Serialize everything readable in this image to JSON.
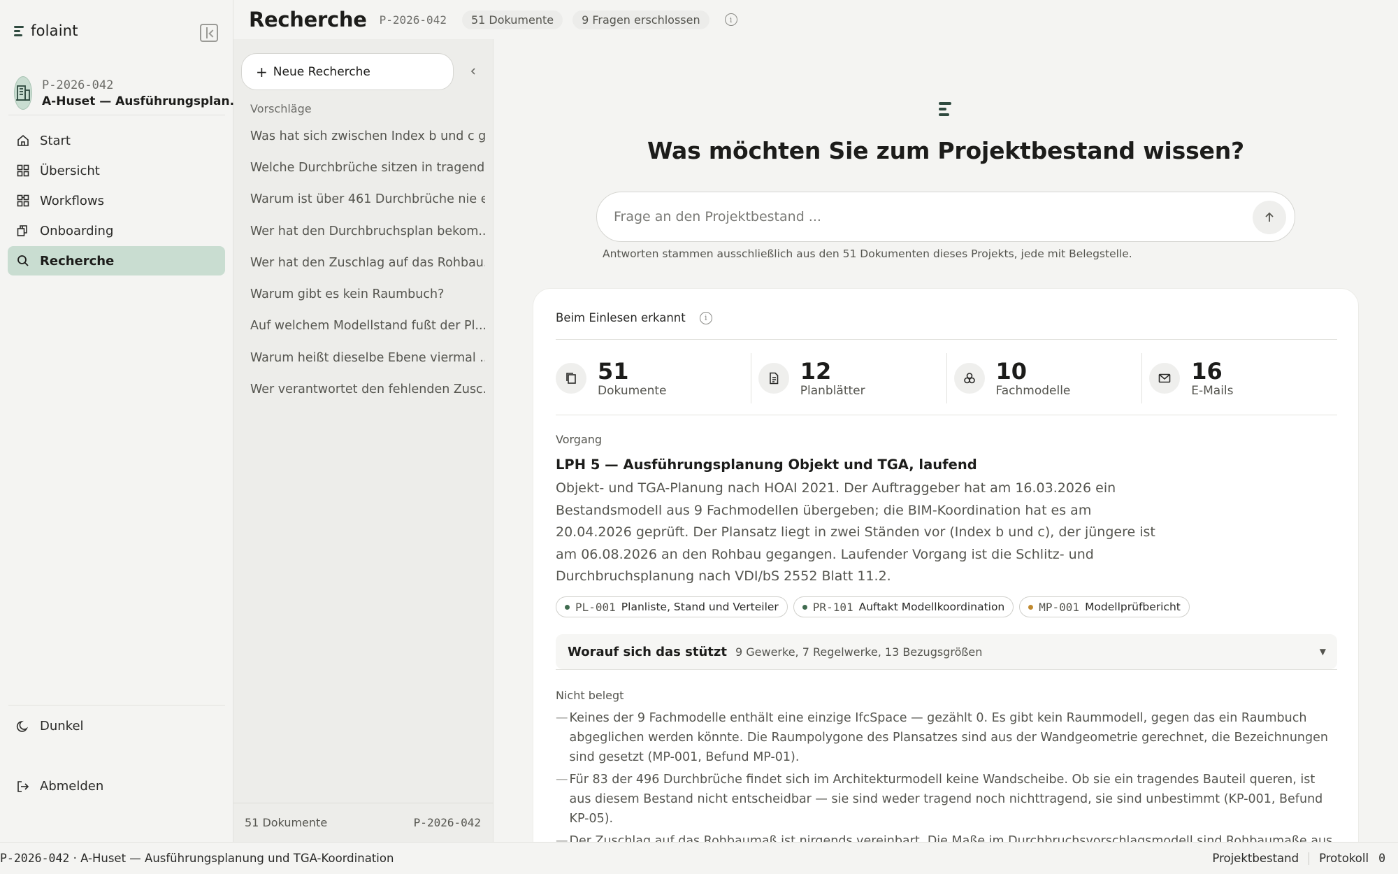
{
  "brand": {
    "name": "folaint"
  },
  "project": {
    "id": "P-2026-042",
    "name": "A-Huset — Ausführungsplan..."
  },
  "nav": [
    {
      "label": "Start",
      "icon": "home-icon"
    },
    {
      "label": "Übersicht",
      "icon": "grid-icon"
    },
    {
      "label": "Workflows",
      "icon": "workflows-icon"
    },
    {
      "label": "Onboarding",
      "icon": "onboarding-icon"
    },
    {
      "label": "Recherche",
      "icon": "search-icon",
      "active": true
    }
  ],
  "bottom": {
    "theme_label": "Dunkel",
    "logout_label": "Abmelden"
  },
  "header": {
    "title": "Recherche",
    "id": "P-2026-042",
    "documents_pill": "51 Dokumente",
    "questions_pill": "9 Fragen erschlossen"
  },
  "suggestions": {
    "new_button": "Neue Recherche",
    "label": "Vorschläge",
    "items": [
      "Was hat sich zwischen Index b und c g...",
      "Welche Durchbrüche sitzen in tragend...",
      "Warum ist über 461 Durchbrüche nie e...",
      "Wer hat den Durchbruchsplan bekom...",
      "Wer hat den Zuschlag auf das Rohbau...",
      "Warum gibt es kein Raumbuch?",
      "Auf welchem Modellstand fußt der Pl...",
      "Warum heißt dieselbe Ebene viermal ...",
      "Wer verantwortet den fehlenden Zusc..."
    ],
    "footer_docs": "51 Dokumente",
    "footer_id": "P-2026-042"
  },
  "main": {
    "question": "Was möchten Sie zum Projektbestand wissen?",
    "input_placeholder": "Frage an den Projektbestand ...",
    "hint": "Antworten stammen ausschließlich aus den 51 Dokumenten dieses Projekts, jede mit Belegstelle.",
    "card": {
      "heading": "Beim Einlesen erkannt",
      "stats": [
        {
          "value": "51",
          "label": "Dokumente",
          "icon": "documents-icon"
        },
        {
          "value": "12",
          "label": "Planblätter",
          "icon": "sheet-icon"
        },
        {
          "value": "10",
          "label": "Fachmodelle",
          "icon": "models-icon"
        },
        {
          "value": "16",
          "label": "E-Mails",
          "icon": "mail-icon"
        }
      ],
      "process_label": "Vorgang",
      "process_title": "LPH 5 — Ausführungsplanung Objekt und TGA, laufend",
      "process_body": "Objekt- und TGA-Planung nach HOAI 2021. Der Auftraggeber hat am 16.03.2026 ein Bestandsmodell aus 9 Fachmodellen übergeben; die BIM-Koordination hat es am 20.04.2026 geprüft. Der Plansatz liegt in zwei Ständen vor (Index b und c), der jüngere ist am 06.08.2026 an den Rohbau gegangen. Laufender Vorgang ist die Schlitz- und Durchbruchsplanung nach VDI/bS 2552 Blatt 11.2.",
      "refs": [
        {
          "code": "PL-001",
          "label": "Planliste, Stand und Verteiler",
          "color": "#3f6b4f"
        },
        {
          "code": "PR-101",
          "label": "Auftakt Modellkoordination",
          "color": "#3f6b4f"
        },
        {
          "code": "MP-001",
          "label": "Modellprüfbericht",
          "color": "#c0892f"
        }
      ],
      "basis_title": "Worauf sich das stützt",
      "basis_sub": "9 Gewerke, 7 Regelwerke, 13 Bezugsgrößen",
      "missing_label": "Nicht belegt",
      "missing": [
        "Keines der 9 Fachmodelle enthält eine einzige IfcSpace — gezählt 0. Es gibt kein Raummodell, gegen das ein Raumbuch abgeglichen werden könnte. Die Raumpolygone des Plansatzes sind aus der Wandgeometrie gerechnet, die Bezeichnungen sind gesetzt (MP-001, Befund MP-01).",
        "Für 83 der 496 Durchbrüche findet sich im Architekturmodell keine Wandscheibe. Ob sie ein tragendes Bauteil queren, ist aus diesem Bestand nicht entscheidbar — sie sind weder tragend noch nichttragend, sie sind unbestimmt (KP-001, Befund KP-05).",
        "Der Zuschlag auf das Rohbaumaß ist nirgends vereinbart. Die Maße im Durchbruchsvorschlagsmodell sind Rohbaumaße aus der Verschneidung Trasse × Wand, ohne Zuschlag; solange er fehlt, prüft die Tragwerksplanung gegen ein Maß, das nicht das"
      ]
    }
  },
  "statusbar": {
    "left": "P-2026-042 · A-Huset — Ausführungsplanung und TGA-Koordination",
    "bestand": "Projektbestand",
    "protokoll": "Protokoll",
    "protokoll_count": "0"
  },
  "colors": {
    "accent": "#c9ddd1",
    "brand": "#2f4a3f",
    "ref_green": "#3f6b4f",
    "ref_amber": "#c0892f"
  }
}
